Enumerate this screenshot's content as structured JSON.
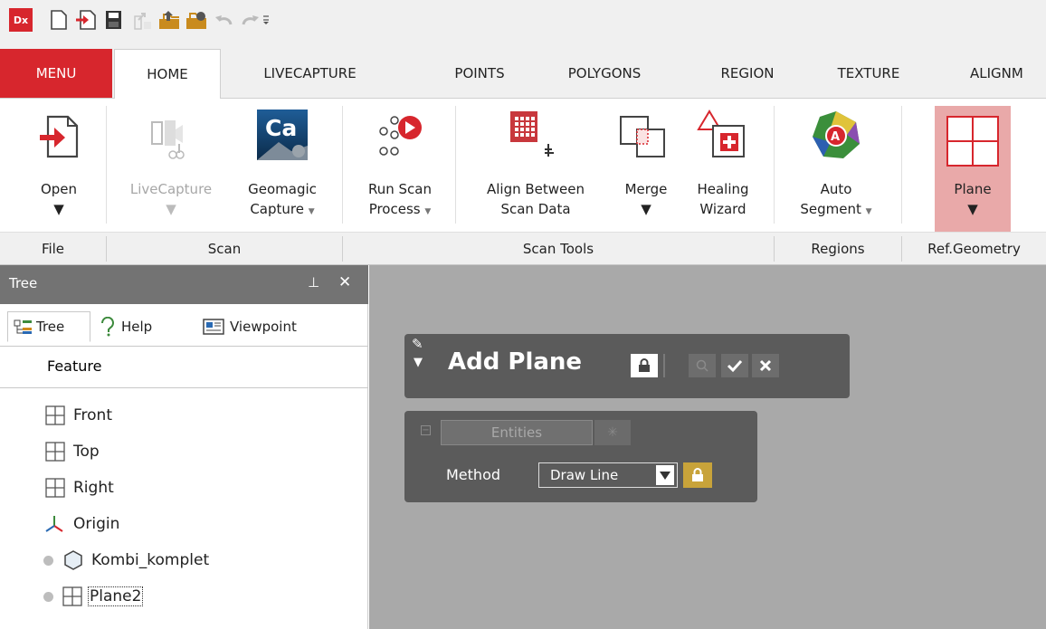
{
  "app": {
    "logo_text": "Dx"
  },
  "quick_access": {
    "icons": [
      "new-document-icon",
      "import-icon",
      "save-icon",
      "export-disabled-icon",
      "export-icon",
      "export-folder-icon",
      "undo-icon",
      "redo-icon",
      "customize-icon"
    ]
  },
  "menu_tabs": [
    "MENU",
    "HOME",
    "LIVECAPTURE",
    "POINTS",
    "POLYGONS",
    "REGION",
    "TEXTURE",
    "ALIGNM"
  ],
  "ribbon": {
    "open": {
      "label": "Open"
    },
    "livecapture": {
      "label": "LiveCapture"
    },
    "geomagic": {
      "line1": "Geomagic",
      "line2": "Capture",
      "icon_text": "Ca"
    },
    "runscan": {
      "line1": "Run Scan",
      "line2": "Process"
    },
    "align": {
      "line1": "Align Between",
      "line2": "Scan Data"
    },
    "merge": {
      "label": "Merge"
    },
    "healing": {
      "line1": "Healing",
      "line2": "Wizard"
    },
    "autoseg": {
      "line1": "Auto",
      "line2": "Segment"
    },
    "plane": {
      "label": "Plane"
    }
  },
  "groups": [
    "File",
    "Scan",
    "Scan Tools",
    "Regions",
    "Ref.Geometry"
  ],
  "panel": {
    "title": "Tree",
    "tabs": [
      "Tree",
      "Help",
      "Viewpoint"
    ],
    "header": "Feature",
    "items": [
      "Front",
      "Top",
      "Right",
      "Origin",
      "Kombi_komplet",
      "Plane2"
    ]
  },
  "dialog": {
    "title": "Add Plane",
    "entities_label": "Entities",
    "method_label": "Method",
    "method_value": "Draw Line"
  },
  "colors": {
    "accent": "#d7262d",
    "panel_title": "#737373",
    "viewport": "#a9a9a9",
    "dialog": "#5b5b5b",
    "lock_yellow": "#c8a33a"
  }
}
